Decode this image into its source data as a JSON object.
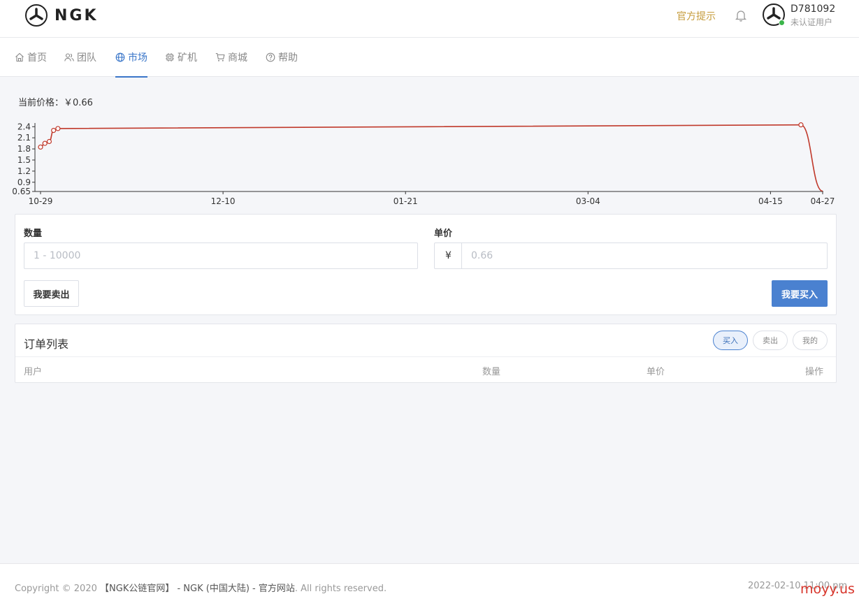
{
  "header": {
    "logo_text": "NGK",
    "notice_link": "官方提示",
    "user_id": "D781092",
    "user_status": "未认证用户"
  },
  "nav": {
    "items": [
      {
        "label": "首页",
        "icon": "home-icon"
      },
      {
        "label": "团队",
        "icon": "users-icon"
      },
      {
        "label": "市场",
        "icon": "globe-icon",
        "active": true
      },
      {
        "label": "矿机",
        "icon": "chip-icon"
      },
      {
        "label": "商城",
        "icon": "cart-icon"
      },
      {
        "label": "帮助",
        "icon": "help-icon"
      }
    ]
  },
  "market": {
    "price_label": "当前价格：￥0.66"
  },
  "chart_data": {
    "type": "line",
    "x_ticks": [
      "10-29",
      "12-10",
      "01-21",
      "03-04",
      "04-15",
      "04-27"
    ],
    "y_ticks": [
      "0.65",
      "0.9",
      "1.2",
      "1.5",
      "1.8",
      "2.1",
      "2.4"
    ],
    "ylim": [
      0.65,
      2.5
    ],
    "color": "#c0392b",
    "series": [
      {
        "x": [
          "10-29",
          "10-30",
          "10-31",
          "11-01",
          "11-02",
          "04-22",
          "04-27"
        ],
        "values": [
          1.85,
          1.95,
          2.0,
          2.3,
          2.35,
          2.45,
          0.66
        ]
      }
    ]
  },
  "trade": {
    "quantity_label": "数量",
    "quantity_placeholder": "1 - 10000",
    "price_label": "单价",
    "currency_symbol": "¥",
    "price_placeholder": "0.66",
    "sell_button": "我要卖出",
    "buy_button": "我要买入"
  },
  "orders": {
    "title": "订单列表",
    "tabs": [
      "买入",
      "卖出",
      "我的"
    ],
    "columns": [
      "用户",
      "数量",
      "单价",
      "操作"
    ]
  },
  "footer": {
    "copyright_prefix": "Copyright © 2020 ",
    "site_name": "【NGK公链官网】",
    "middle": " - NGK (中国大陆) - ",
    "official": "官方网站",
    "suffix": ". All rights reserved.",
    "datetime": "2022-02-10 11:00 pm",
    "watermark": "moyy.us"
  }
}
